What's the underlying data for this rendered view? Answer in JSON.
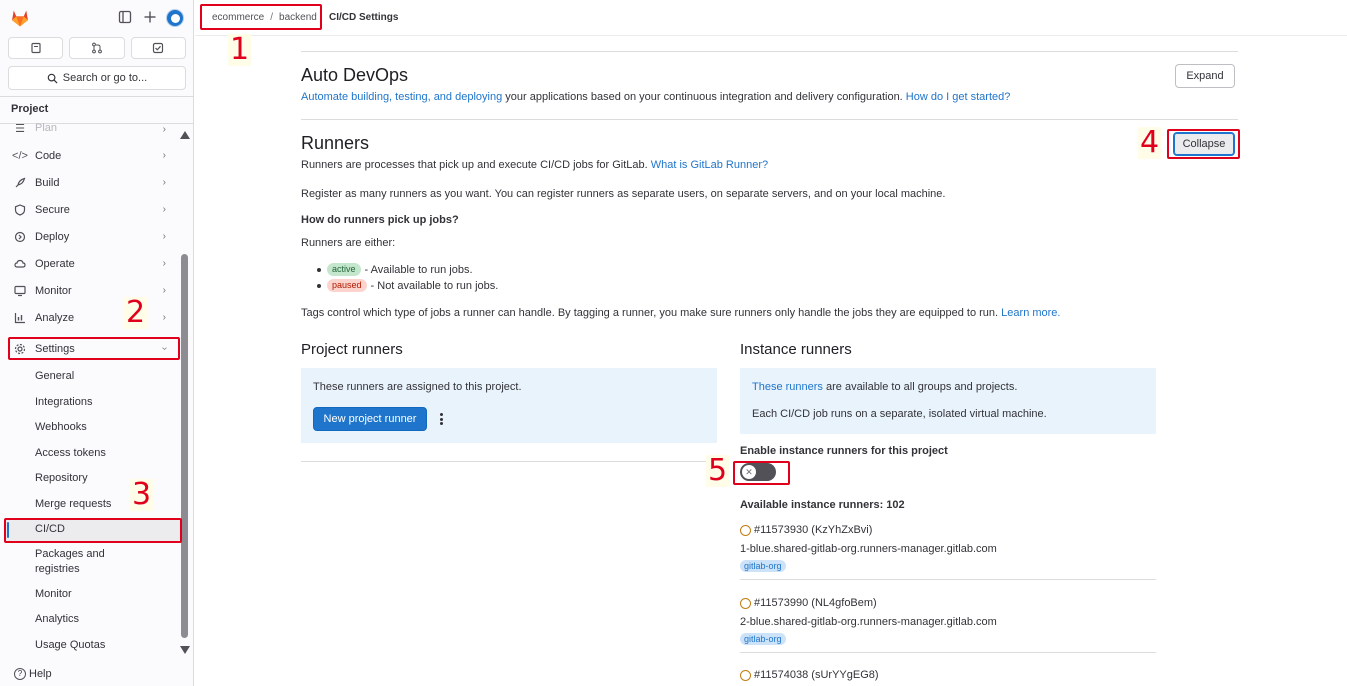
{
  "sidebar": {
    "section_title": "Project",
    "search_placeholder": "Search or go to...",
    "nav_items": [
      {
        "label": "Plan",
        "icon": "plan-icon"
      },
      {
        "label": "Code",
        "icon": "code-icon"
      },
      {
        "label": "Build",
        "icon": "rocket-icon"
      },
      {
        "label": "Secure",
        "icon": "shield-icon"
      },
      {
        "label": "Deploy",
        "icon": "deploy-icon"
      },
      {
        "label": "Operate",
        "icon": "cloud-icon"
      },
      {
        "label": "Monitor",
        "icon": "monitor-icon"
      },
      {
        "label": "Analyze",
        "icon": "chart-icon"
      },
      {
        "label": "Settings",
        "icon": "gear-icon"
      }
    ],
    "settings_sub_items": [
      "General",
      "Integrations",
      "Webhooks",
      "Access tokens",
      "Repository",
      "Merge requests",
      "CI/CD",
      "Packages and\nregistries",
      "Monitor",
      "Analytics",
      "Usage Quotas"
    ],
    "help_label": "Help"
  },
  "breadcrumb": {
    "group": "ecommerce",
    "separator": "/",
    "project": "backend",
    "current": "CI/CD Settings"
  },
  "auto_devops": {
    "title": "Auto DevOps",
    "link_text": "Automate building, testing, and deploying",
    "desc_text": " your applications based on your continuous integration and delivery configuration. ",
    "help_link": "How do I get started?",
    "expand_label": "Expand"
  },
  "runners": {
    "title": "Runners",
    "desc": "Runners are processes that pick up and execute CI/CD jobs for GitLab. ",
    "desc_link": "What is GitLab Runner?",
    "collapse_label": "Collapse",
    "register_text": "Register as many runners as you want. You can register runners as separate users, on separate servers, and on your local machine.",
    "how_title": "How do runners pick up jobs?",
    "either_text": "Runners are either:",
    "active_badge": "active",
    "active_text": " - Available to run jobs.",
    "paused_badge": "paused",
    "paused_text": " - Not available to run jobs.",
    "tags_text": "Tags control which type of jobs a runner can handle. By tagging a runner, you make sure runners only handle the jobs they are equipped to run. ",
    "tags_link": "Learn more."
  },
  "project_runners": {
    "title": "Project runners",
    "info": "These runners are assigned to this project.",
    "new_button": "New project runner"
  },
  "instance_runners": {
    "title": "Instance runners",
    "info_link": "These runners",
    "info_text": " are available to all groups and projects.",
    "info_text2": "Each CI/CD job runs on a separate, isolated virtual machine.",
    "toggle_label": "Enable instance runners for this project",
    "toggle_on": false,
    "available_label": "Available instance runners: 102",
    "runners": [
      {
        "id": "#11573930 (KzYhZxBvi)",
        "host": "1-blue.shared-gitlab-org.runners-manager.gitlab.com",
        "tag": "gitlab-org"
      },
      {
        "id": "#11573990 (NL4gfoBem)",
        "host": "2-blue.shared-gitlab-org.runners-manager.gitlab.com",
        "tag": "gitlab-org"
      },
      {
        "id": "#11574038 (sUrYYgEG8)",
        "host": "",
        "tag": ""
      }
    ]
  },
  "annotations": [
    "1",
    "2",
    "3",
    "4",
    "5"
  ],
  "colors": {
    "accent": "#1f75cb",
    "annotation": "#e0001b",
    "sidebar_bg": "#fbfafd"
  }
}
